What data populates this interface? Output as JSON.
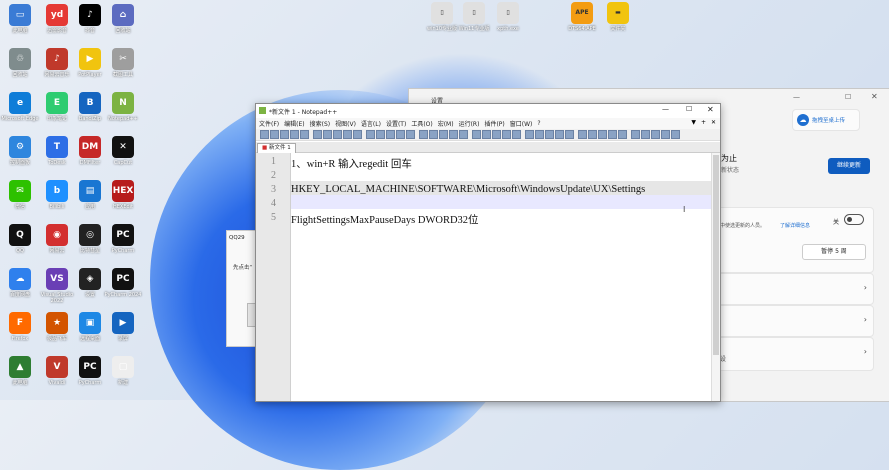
{
  "desktop_icons": [
    {
      "id": "c1",
      "label": "此电脑",
      "color": "#3a7bd5",
      "glyph": "▭"
    },
    {
      "id": "c2",
      "label": "回收站",
      "color": "#7f8c8d",
      "glyph": "♲"
    },
    {
      "id": "c3",
      "label": "Microsoft Edge",
      "color": "#0f7dd8",
      "glyph": "e"
    },
    {
      "id": "c4",
      "label": "控制面板",
      "color": "#2e86de",
      "glyph": "⚙"
    },
    {
      "id": "c5",
      "label": "微信",
      "color": "#2dc100",
      "glyph": "✉"
    },
    {
      "id": "c6",
      "label": "QQ",
      "color": "#111",
      "glyph": "Q"
    },
    {
      "id": "c7",
      "label": "百度网盘",
      "color": "#2f80ed",
      "glyph": "☁"
    },
    {
      "id": "c8",
      "label": "Firefox",
      "color": "#ff6a00",
      "glyph": "F"
    },
    {
      "id": "c9",
      "label": "此电脑",
      "color": "#2e7d32",
      "glyph": "▲"
    },
    {
      "id": "d1",
      "label": "迅雷影音",
      "color": "#e53935",
      "glyph": "yd"
    },
    {
      "id": "d2",
      "label": "网易云音乐",
      "color": "#c0392b",
      "glyph": "♪"
    },
    {
      "id": "d3",
      "label": "印象笔记",
      "color": "#2ecc71",
      "glyph": "E"
    },
    {
      "id": "d4",
      "label": "ToDesk",
      "color": "#2d6ee6",
      "glyph": "T"
    },
    {
      "id": "d5",
      "label": "Bilibili",
      "color": "#1e90ff",
      "glyph": "b"
    },
    {
      "id": "d6",
      "label": "网易云",
      "color": "#d32f2f",
      "glyph": "◉"
    },
    {
      "id": "d7",
      "label": "Visual Studio 2022",
      "color": "#6a3fb5",
      "glyph": "VS"
    },
    {
      "id": "d8",
      "label": "极品飞车",
      "color": "#d35400",
      "glyph": "★"
    },
    {
      "id": "d9",
      "label": "Vivaldi",
      "color": "#c0392b",
      "glyph": "V"
    },
    {
      "id": "e1",
      "label": "抖音",
      "color": "#000",
      "glyph": "♪"
    },
    {
      "id": "e2",
      "label": "PotPlayer",
      "color": "#f1c40f",
      "glyph": "▶"
    },
    {
      "id": "e3",
      "label": "BandiZip",
      "color": "#1565c0",
      "glyph": "B"
    },
    {
      "id": "e4",
      "label": "DMFilter",
      "color": "#c62828",
      "glyph": "DM"
    },
    {
      "id": "e5",
      "label": "应用",
      "color": "#1976d2",
      "glyph": "▤"
    },
    {
      "id": "e6",
      "label": "比特彗星",
      "color": "#222",
      "glyph": "◎"
    },
    {
      "id": "e7",
      "label": "设置",
      "color": "#222",
      "glyph": "◈"
    },
    {
      "id": "e8",
      "label": "远程桌面",
      "color": "#1e88e5",
      "glyph": "▣"
    },
    {
      "id": "e9",
      "label": "PyCharm",
      "color": "#111",
      "glyph": "PC"
    },
    {
      "id": "f1",
      "label": "回收站",
      "color": "#5c6bc0",
      "glyph": "⌂"
    },
    {
      "id": "f2",
      "label": "截图工具",
      "color": "#9e9e9e",
      "glyph": "✂"
    },
    {
      "id": "f3",
      "label": "Notepad++",
      "color": "#7cb342",
      "glyph": "N"
    },
    {
      "id": "f4",
      "label": "CapCut",
      "color": "#111",
      "glyph": "✕"
    },
    {
      "id": "f5",
      "label": "HEXEdit",
      "color": "#b71c1c",
      "glyph": "HEX"
    },
    {
      "id": "f6",
      "label": "PyCharm",
      "color": "#111",
      "glyph": "PC"
    },
    {
      "id": "f7",
      "label": "PyCharm 2024",
      "color": "#111",
      "glyph": "PC"
    },
    {
      "id": "f8",
      "label": "录屏",
      "color": "#1565c0",
      "glyph": "▶"
    },
    {
      "id": "f9",
      "label": "新建",
      "color": "#eee",
      "glyph": "▢"
    }
  ],
  "top_files": [
    {
      "label": "win10专业版",
      "color": "#e0e0e0",
      "glyph": "▯"
    },
    {
      "label": "Win11专业版",
      "color": "#e0e0e0",
      "glyph": "▯"
    },
    {
      "label": "xpth.exe",
      "color": "#e0e0e0",
      "glyph": "▯"
    },
    {
      "label": "DTS64.APE",
      "color": "#f39c12",
      "glyph": "APE"
    },
    {
      "label": "文件夹",
      "color": "#f1c40f",
      "glyph": "▬"
    }
  ],
  "settings": {
    "title": "设置",
    "onedrive_label": "拖拽至桌上传",
    "partial_heading": "为止",
    "partial_sub": "新状态",
    "check_button": "继续更新",
    "toggle_label": "关",
    "link_text": "了解详细信息",
    "partial_text": "中使选更新的人员。",
    "pause_select": "暂停 5 周",
    "footer_partial": "设"
  },
  "dialog": {
    "title": "QQ29",
    "line": "先点击“"
  },
  "notepad": {
    "title": "*新文件 1 - Notepad++",
    "menu": [
      "文件(F)",
      "编辑(E)",
      "搜索(S)",
      "视图(V)",
      "语言(L)",
      "设置(T)",
      "工具(O)",
      "宏(M)",
      "运行(R)",
      "插件(P)",
      "窗口(W)",
      "?"
    ],
    "tab": "新文件 1",
    "lines": [
      {
        "n": "1",
        "text": "1、win+R 输入regedit 回车"
      },
      {
        "n": "2",
        "text": ""
      },
      {
        "n": "3",
        "text": "HKEY_LOCAL_MACHINE\\SOFTWARE\\Microsoft\\WindowsUpdate\\UX\\Settings"
      },
      {
        "n": "4",
        "text": ""
      },
      {
        "n": "5",
        "text": "FlightSettingsMaxPauseDays DWORD32位"
      }
    ]
  }
}
